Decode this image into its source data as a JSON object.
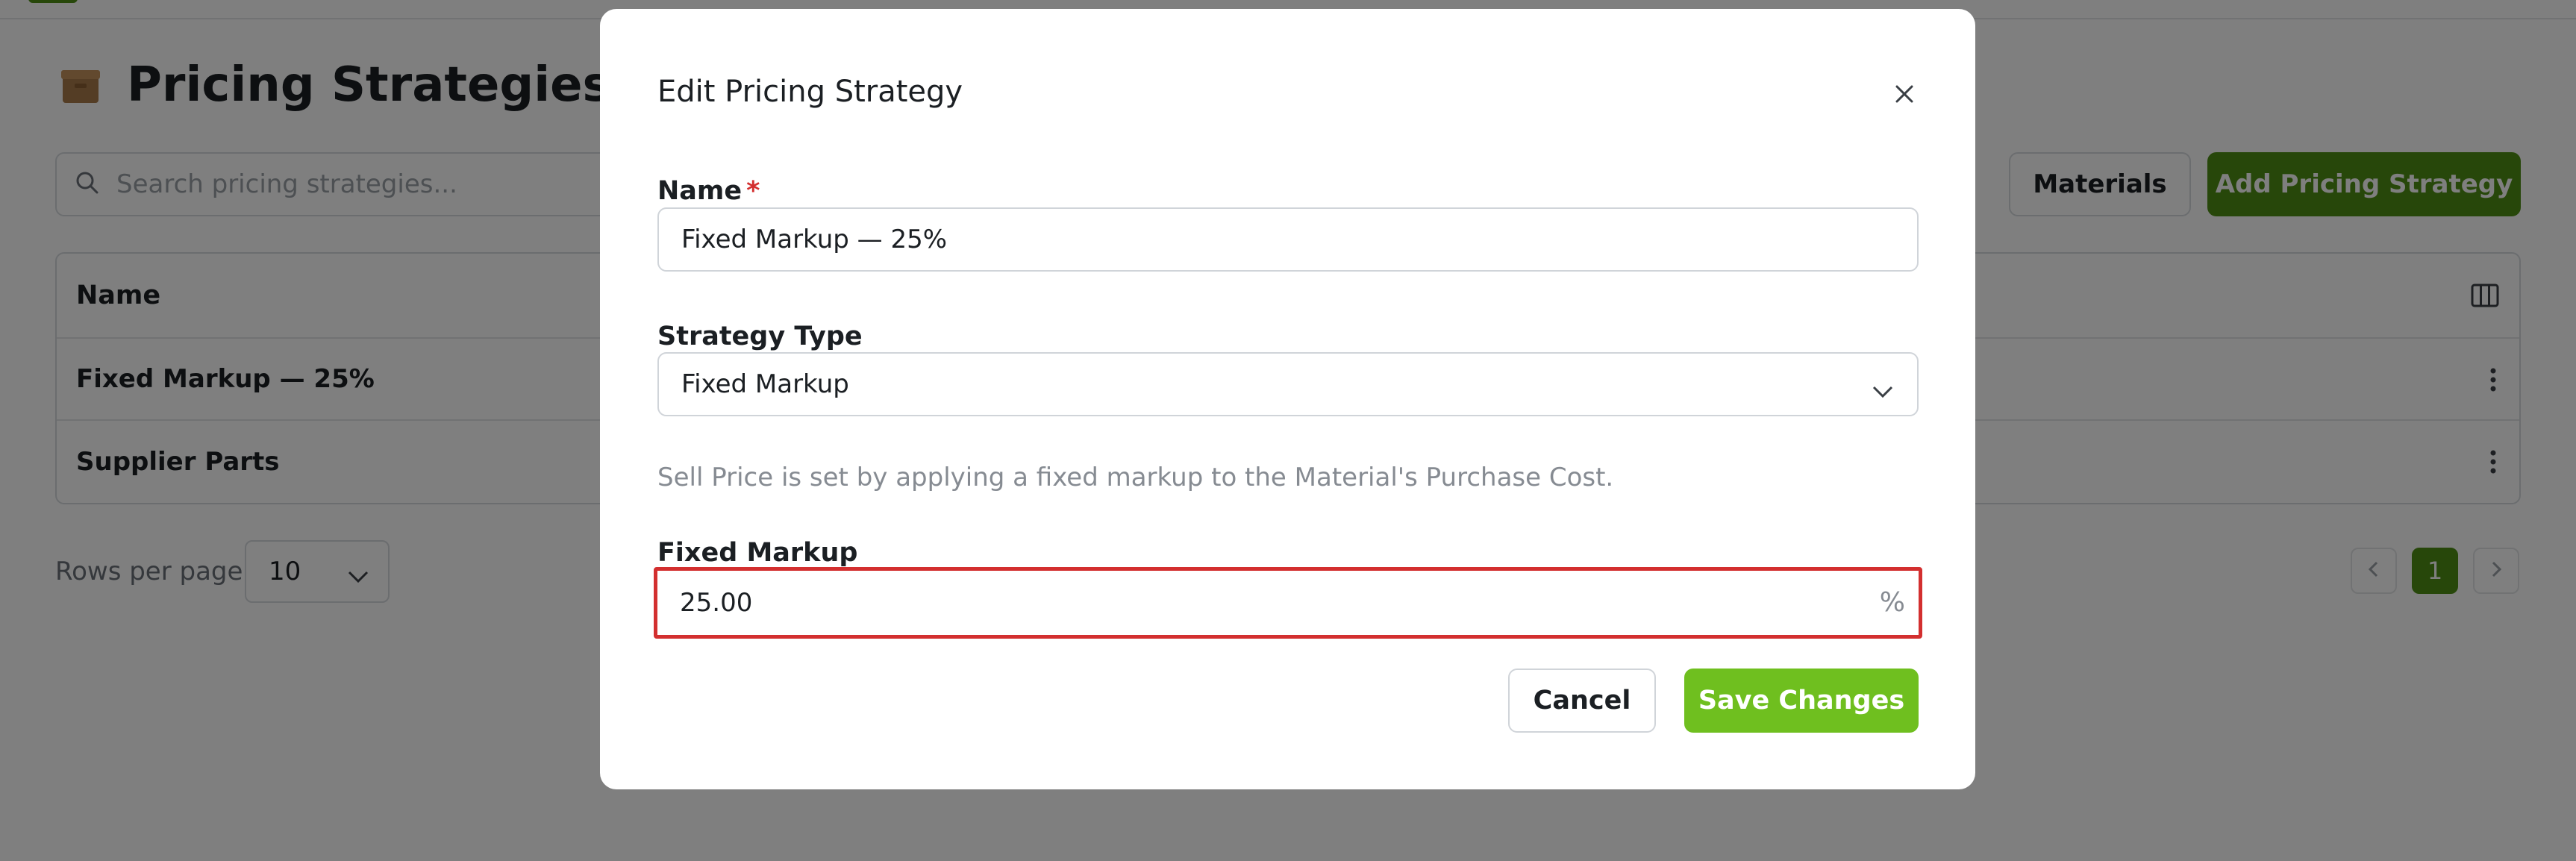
{
  "page": {
    "title": "Pricing Strategies",
    "search_placeholder": "Search pricing strategies...",
    "materials_label": "Materials",
    "add_label": "Add Pricing Strategy",
    "table": {
      "column_header": "Name",
      "rows": [
        "Fixed Markup — 25%",
        "Supplier Parts"
      ]
    },
    "rows_per_page_label": "Rows per page",
    "rows_per_page_value": "10",
    "current_page": "1"
  },
  "modal": {
    "title": "Edit Pricing Strategy",
    "name_label": "Name",
    "required_mark": "*",
    "name_value": "Fixed Markup — 25%",
    "type_label": "Strategy Type",
    "type_value": "Fixed Markup",
    "help_text": "Sell Price is set by applying a fixed markup to the Material's Purchase Cost.",
    "markup_label": "Fixed Markup",
    "markup_value": "25.00",
    "markup_suffix": "%",
    "cancel_label": "Cancel",
    "save_label": "Save Changes"
  },
  "colors": {
    "brand_green": "#4e8e14",
    "save_green": "#6fbf1f",
    "error_red": "#d32f2f"
  },
  "icons": [
    "box-icon",
    "search-icon",
    "columns-icon",
    "kebab-icon",
    "chevron-down-icon",
    "chevron-left-icon",
    "chevron-right-icon",
    "close-icon"
  ]
}
